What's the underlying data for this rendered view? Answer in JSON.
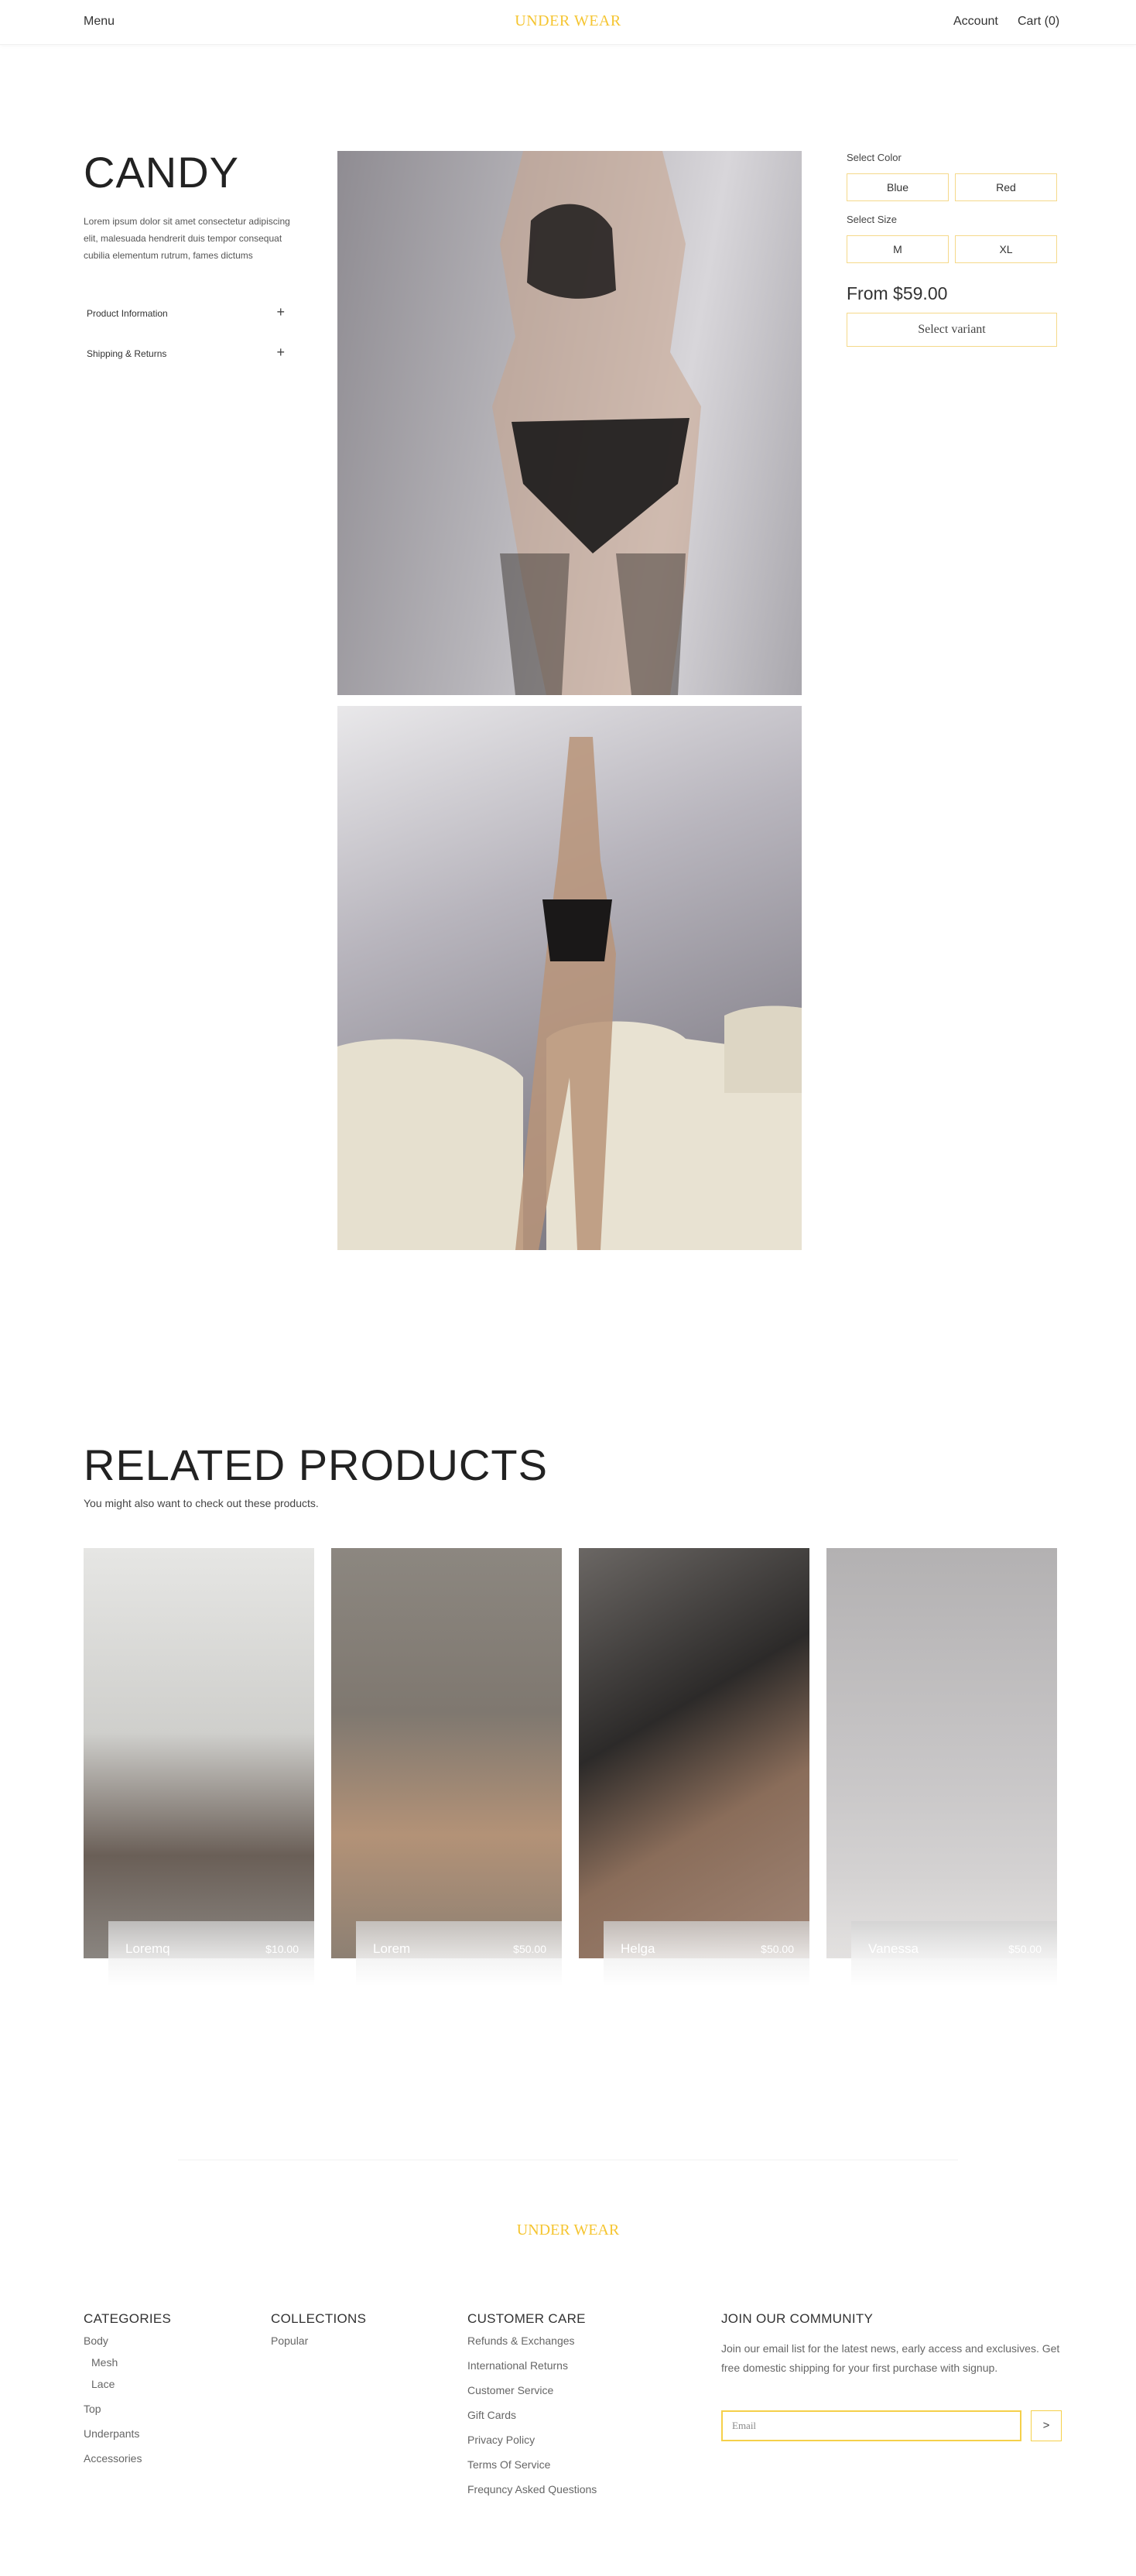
{
  "header": {
    "menu": "Menu",
    "brand": "UNDER WEAR",
    "account": "Account",
    "cart": "Cart (0)"
  },
  "product": {
    "title": "CANDY",
    "description": "Lorem ipsum dolor sit amet consectetur adipiscing elit, malesuada hendrerit duis tempor consequat cubilia elementum rutrum, fames dictums",
    "accordions": [
      {
        "label": "Product Information"
      },
      {
        "label": "Shipping & Returns"
      }
    ],
    "color": {
      "label": "Select Color",
      "options": [
        "Blue",
        "Red"
      ]
    },
    "size": {
      "label": "Select Size",
      "options": [
        "M",
        "XL"
      ]
    },
    "price": "From $59.00",
    "select_variant": "Select variant"
  },
  "related": {
    "title": "RELATED PRODUCTS",
    "subtitle": "You might also want to check out these products.",
    "items": [
      {
        "name": "Loremq",
        "price": "$10.00"
      },
      {
        "name": "Lorem",
        "price": "$50.00"
      },
      {
        "name": "Helga",
        "price": "$50.00"
      },
      {
        "name": "Vanessa",
        "price": "$50.00"
      }
    ]
  },
  "footer": {
    "brand": "UNDER WEAR",
    "categories": {
      "title": "CATEGORIES",
      "items": [
        "Body",
        "Mesh",
        "Lace",
        "Top",
        "Underpants",
        "Accessories"
      ]
    },
    "collections": {
      "title": "COLLECTIONS",
      "items": [
        "Popular"
      ]
    },
    "customer_care": {
      "title": "CUSTOMER CARE",
      "items": [
        "Refunds & Exchanges",
        "International Returns",
        "Customer Service",
        "Gift Cards",
        "Privacy Policy",
        "Terms Of Service",
        "Frequncy Asked Questions"
      ]
    },
    "community": {
      "title": "JOIN OUR COMMUNITY",
      "text": "Join our email list for the latest news, early access and exclusives. Get free domestic shipping for your first purchase with signup.",
      "email_placeholder": "Email",
      "submit": ">"
    }
  }
}
